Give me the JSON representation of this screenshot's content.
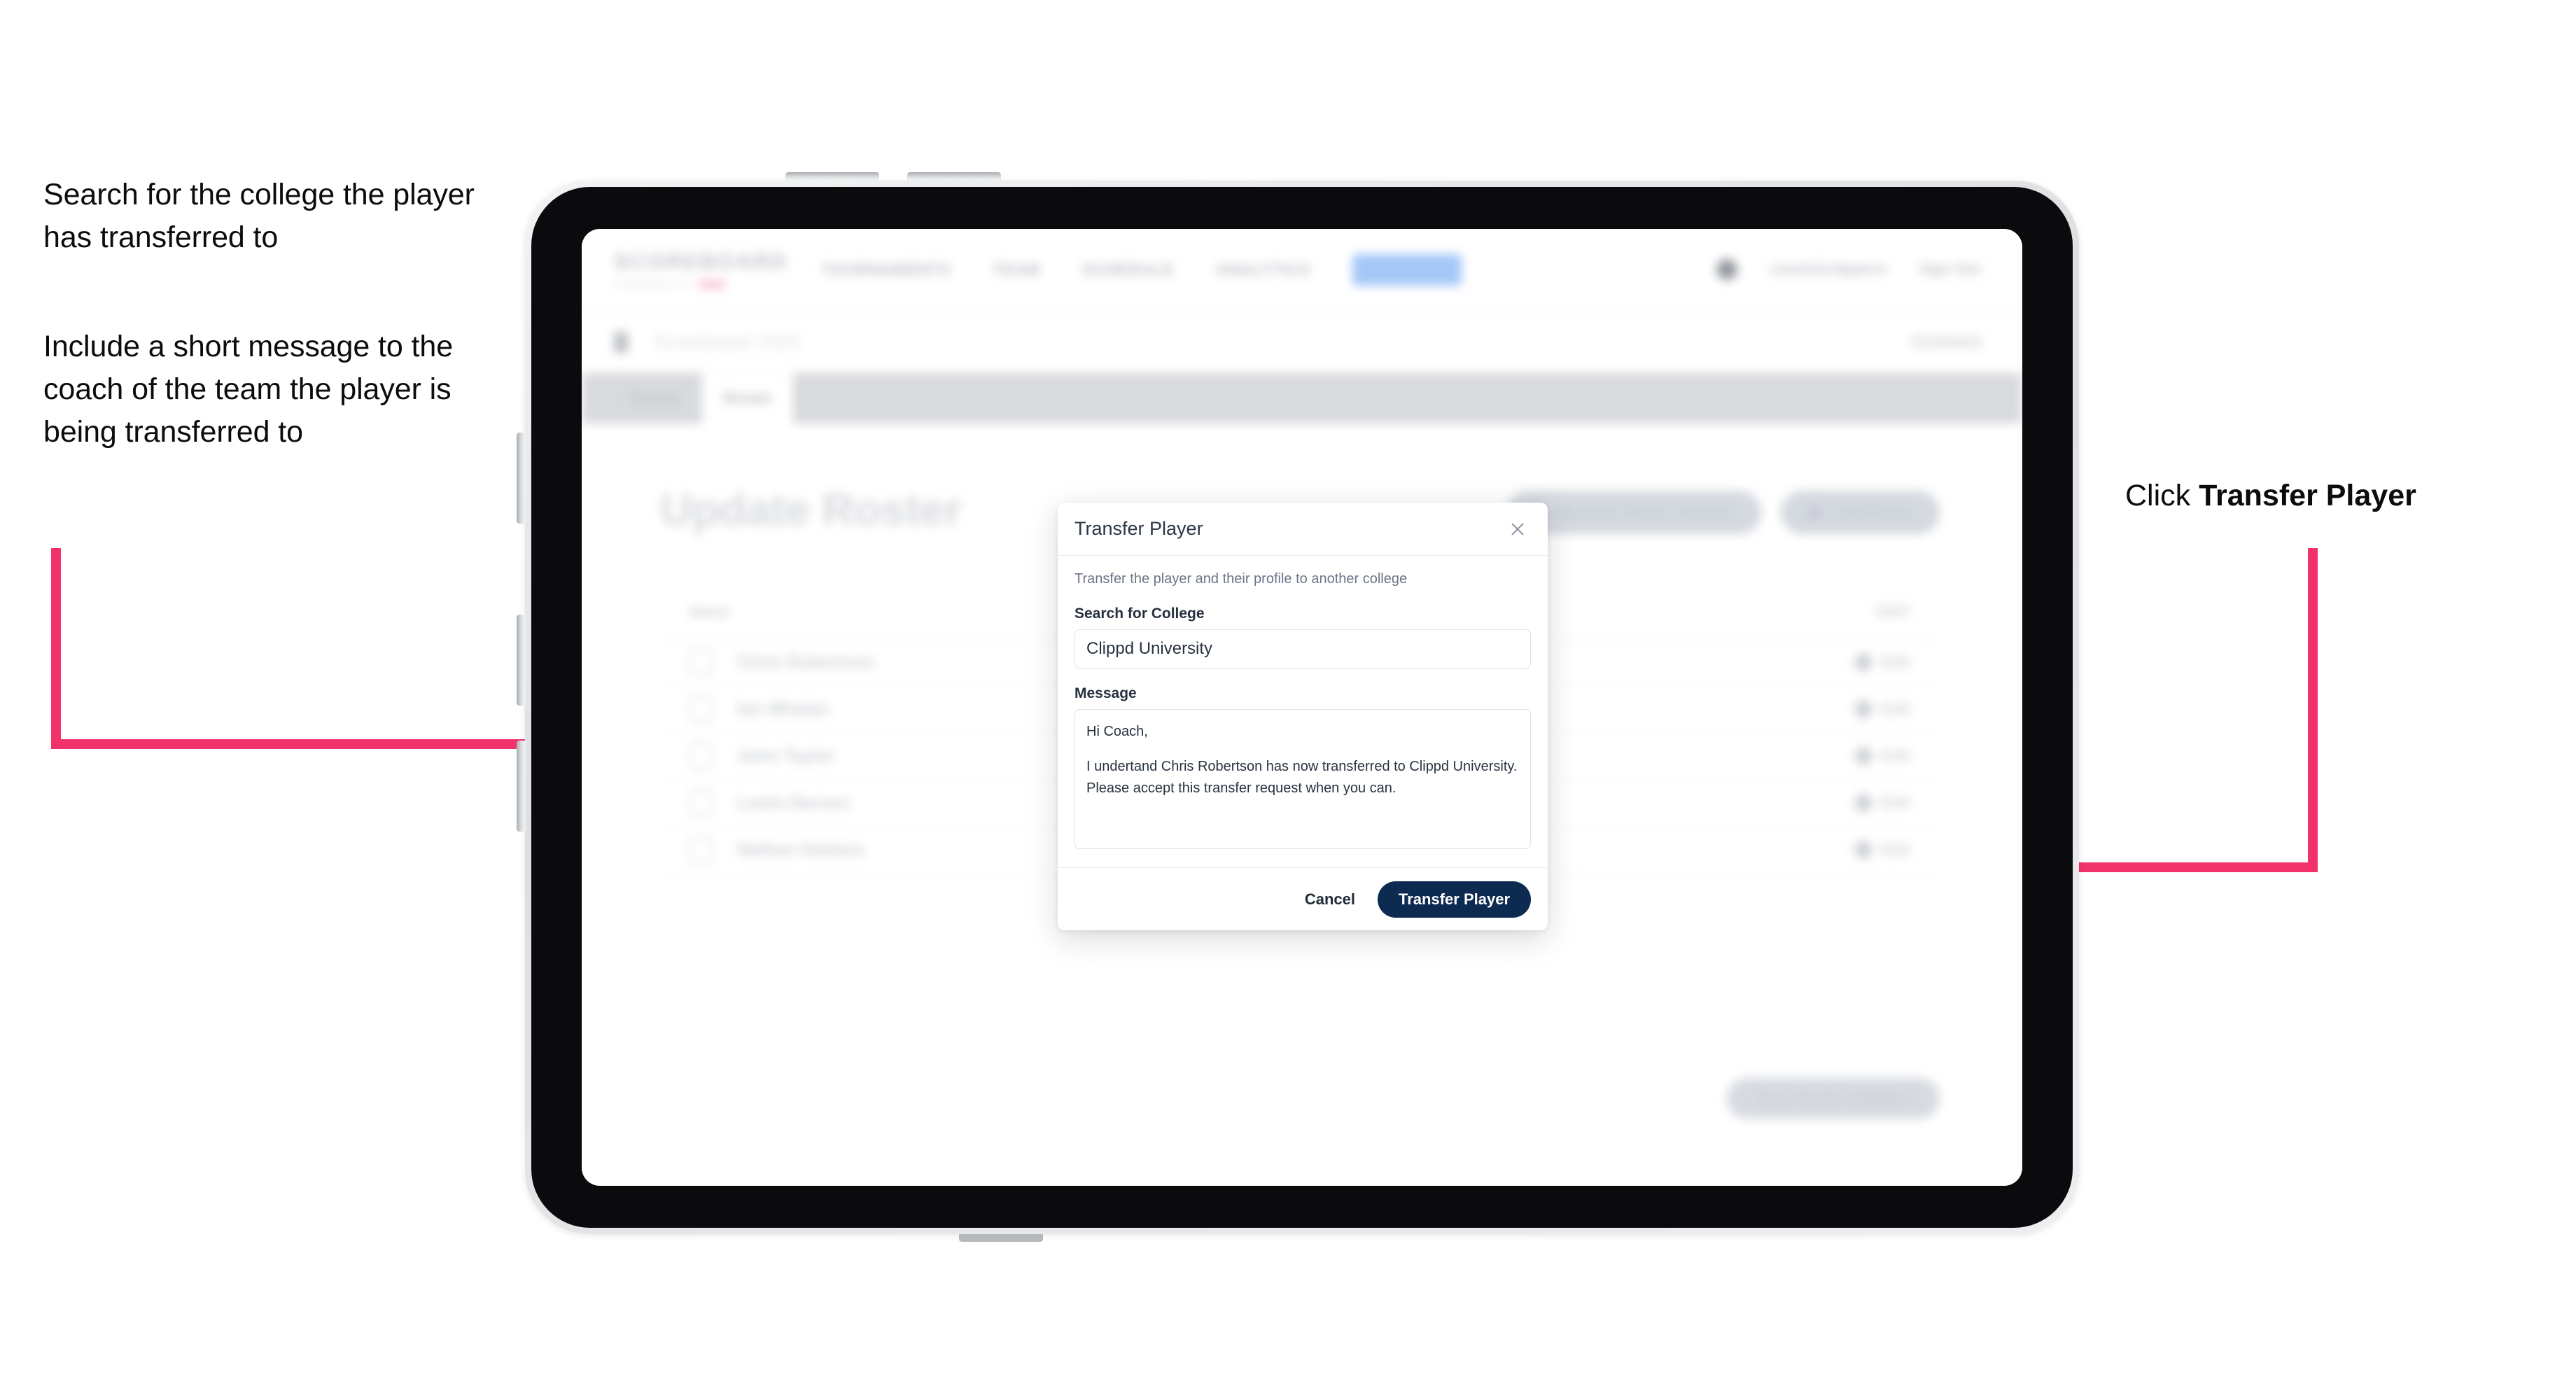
{
  "annotations": {
    "left_1": "Search for the college the player has transferred to",
    "left_2": "Include a short message to the coach of the team the player is being transferred to",
    "right_prefix": "Click ",
    "right_bold": "Transfer Player"
  },
  "colors": {
    "arrow_pink": "#F2336B",
    "primary_navy": "#0D2A50",
    "modal_border": "#DFE3E9",
    "text_dark": "#26303F"
  },
  "app": {
    "brand": {
      "word": "SCOREBOARD",
      "sub_text": "POWERED BY",
      "sub_badge": ""
    },
    "nav": [
      {
        "label": "TOURNAMENTS"
      },
      {
        "label": "TEAM"
      },
      {
        "label": "SCHEDULE"
      },
      {
        "label": "ANALYTICS"
      }
    ],
    "nav_pill": {
      "label": "ROSTER"
    },
    "header_right": {
      "user": "coach@clippd.io",
      "signout": "Sign Out"
    },
    "breadcrumb": {
      "icon": "building-icon",
      "text": "Scoreboard",
      "sub": "2024"
    },
    "subbar_right": "Connect",
    "tabs": [
      {
        "label": "Details",
        "active": false
      },
      {
        "label": "Roster",
        "active": true
      }
    ],
    "page_title": "Update Roster",
    "top_actions": [
      {
        "icon": "download-icon",
        "label": "Request Player Transfer"
      },
      {
        "icon": "plus-icon",
        "label": "Add Player"
      }
    ],
    "roster": {
      "columns": {
        "name": "Name",
        "action": "EDIT"
      },
      "rows": [
        {
          "name": "Chris Robertson",
          "action": "Edit"
        },
        {
          "name": "Ian Whelan",
          "action": "Edit"
        },
        {
          "name": "John Taylor",
          "action": "Edit"
        },
        {
          "name": "Lewis Barnes",
          "action": "Edit"
        },
        {
          "name": "Nathan Holmes",
          "action": "Edit"
        }
      ]
    },
    "bottom_button": "Save Roster Updates"
  },
  "modal": {
    "title": "Transfer Player",
    "close_icon": "close-icon",
    "description": "Transfer the player and their profile to another college",
    "college_label": "Search for College",
    "college_value": "Clippd University",
    "college_placeholder": "Search for College",
    "message_label": "Message",
    "message_lines": [
      "Hi Coach,",
      "I undertand Chris Robertson has now transferred to Clippd University. Please accept this transfer request when you can."
    ],
    "cancel_label": "Cancel",
    "submit_label": "Transfer Player"
  }
}
